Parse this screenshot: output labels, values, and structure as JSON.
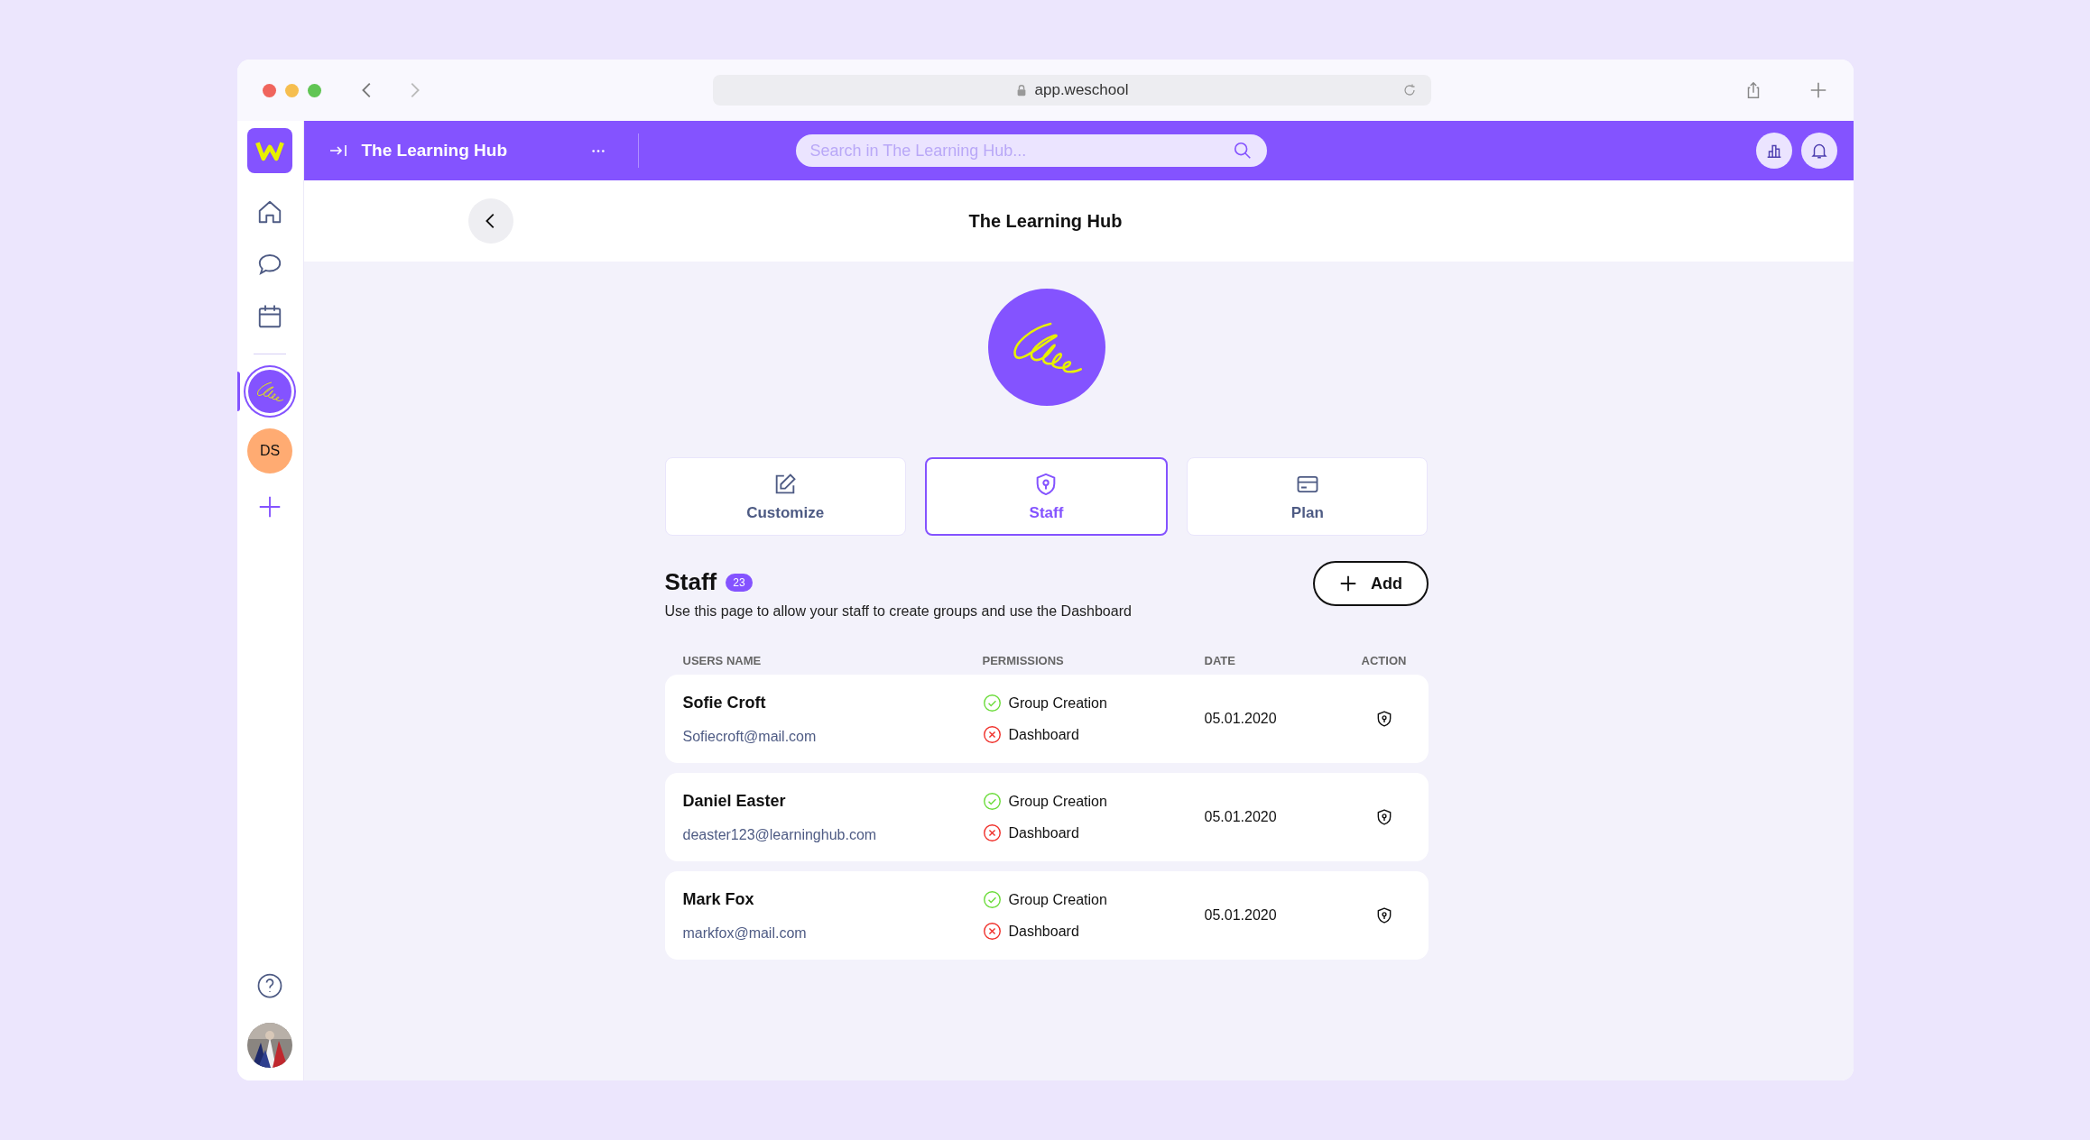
{
  "browser": {
    "address": "app.weschool"
  },
  "header": {
    "title": "The Learning Hub",
    "search": {
      "placeholder": "Search in The Learning Hub..."
    }
  },
  "sidebar": {
    "spaces": [
      {
        "kind": "logo",
        "selected": true
      },
      {
        "kind": "initials",
        "initials": "DS",
        "selected": false
      }
    ]
  },
  "page": {
    "title": "The Learning Hub"
  },
  "tabs": [
    {
      "label": "Customize",
      "selected": false
    },
    {
      "label": "Staff",
      "selected": true
    },
    {
      "label": "Plan",
      "selected": false
    }
  ],
  "staff": {
    "title": "Staff",
    "count": "23",
    "description": "Use this page to allow your staff to create groups and use the Dashboard",
    "add_button": "Add"
  },
  "table": {
    "columns": [
      "USERS NAME",
      "PERMISSIONS",
      "DATE",
      "ACTION"
    ],
    "rows": [
      {
        "name": "Sofie Croft",
        "email": "Sofiecroft@mail.com",
        "permissions": [
          {
            "label": "Group Creation",
            "granted": true
          },
          {
            "label": "Dashboard",
            "granted": false
          }
        ],
        "date": "05.01.2020"
      },
      {
        "name": "Daniel Easter",
        "email": "deaster123@learninghub.com",
        "permissions": [
          {
            "label": "Group Creation",
            "granted": true
          },
          {
            "label": "Dashboard",
            "granted": false
          }
        ],
        "date": "05.01.2020"
      },
      {
        "name": "Mark Fox",
        "email": "markfox@mail.com",
        "permissions": [
          {
            "label": "Group Creation",
            "granted": true
          },
          {
            "label": "Dashboard",
            "granted": false
          }
        ],
        "date": "05.01.2020"
      }
    ]
  }
}
